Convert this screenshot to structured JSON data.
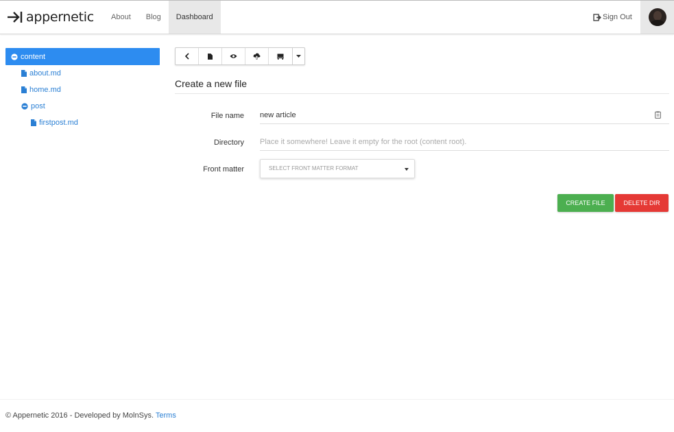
{
  "navbar": {
    "brand": "appernetic",
    "links": [
      {
        "label": "About",
        "active": false
      },
      {
        "label": "Blog",
        "active": false
      },
      {
        "label": "Dashboard",
        "active": true
      }
    ],
    "signout_label": "Sign Out"
  },
  "tree": {
    "root": {
      "label": "content",
      "icon": "minus-circle-icon"
    },
    "items": [
      {
        "label": "about.md",
        "icon": "file-icon"
      },
      {
        "label": "home.md",
        "icon": "file-icon"
      },
      {
        "label": "post",
        "icon": "minus-circle-icon"
      },
      {
        "label": "firstpost.md",
        "icon": "file-icon"
      }
    ]
  },
  "toolbar": {
    "buttons": [
      "back-icon",
      "file-icon",
      "eye-icon",
      "cloud-upload-icon",
      "desk-icon",
      "caret-down-icon"
    ]
  },
  "form": {
    "title": "Create a new file",
    "file_name_label": "File name",
    "file_name_value": "new article",
    "directory_label": "Directory",
    "directory_placeholder": "Place it somewhere! Leave it empty for the root (content root).",
    "front_matter_label": "Front matter",
    "front_matter_select": "SELECT FRONT MATTER FORMAT",
    "create_label": "CREATE FILE",
    "delete_label": "DELETE DIR"
  },
  "footer": {
    "text": "© Appernetic 2016 - Developed by MolnSys.",
    "terms": "Terms"
  },
  "colors": {
    "accent": "#2d8cf0",
    "link": "#2a7fd4",
    "create": "#4caf50",
    "delete": "#e53935"
  }
}
